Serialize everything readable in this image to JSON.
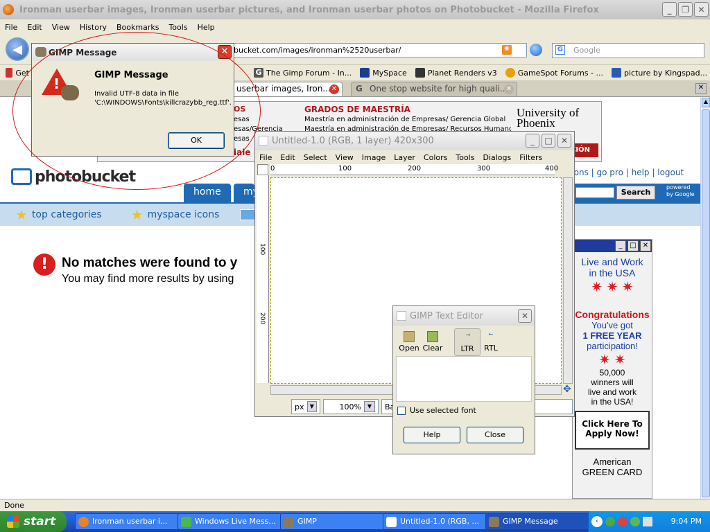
{
  "firefox": {
    "title": "Ironman userbar images, Ironman userbar pictures, and Ironman userbar photos on Photobucket - Mozilla Firefox",
    "menu": [
      "File",
      "Edit",
      "View",
      "History",
      "Bookmarks",
      "Tools",
      "Help"
    ],
    "url": "bucket.com/images/ironman%2520userbar/",
    "search_placeholder": "Google",
    "bookmarks": [
      {
        "label": "Get"
      },
      {
        "label": "The Gimp Forum - In..."
      },
      {
        "label": "MySpace"
      },
      {
        "label": "Planet Renders v3"
      },
      {
        "label": "GameSpot Forums - ..."
      },
      {
        "label": "picture by Kingspad..."
      }
    ],
    "tabs": [
      {
        "label": "userbar images, Iron..."
      },
      {
        "label": "One stop website for high quali..."
      }
    ],
    "status": "Done"
  },
  "page": {
    "ad": {
      "left_col": [
        "OS",
        "esas",
        "esas/Gerencia",
        "esas"
      ],
      "heading": "GRADOS DE MAESTRÍA",
      "line1": "Maestría en administración de Empresas/ Gerencia Global",
      "line2": "Maestría en administración de Empresas/ Recursos Humanos",
      "brand": "University of Phoenix",
      "cta": "CIÓN",
      "cut_text": "iale"
    },
    "logo": "photobucket",
    "toplinks": [
      "ptions",
      "go pro",
      "help",
      "logout"
    ],
    "nav_tabs": [
      "home",
      "my"
    ],
    "search_button": "Search",
    "powered": "powered by Google",
    "categories": [
      "top categories",
      "myspace icons"
    ],
    "no_match_title": "No matches were found to y",
    "no_match_sub": "You may find more results by using",
    "side_ad": {
      "l1": "Live and Work",
      "l2": "in the USA",
      "l3": "Congratulations",
      "l4": "You've got",
      "l5": "1 FREE YEAR",
      "l6": "participation!",
      "l7": "50,000",
      "l8": "winners will",
      "l9": "live and work",
      "l10": "in the USA!",
      "button": "Click Here To Apply Now!",
      "l11": "American",
      "l12": "GREEN CARD"
    }
  },
  "gimp_image": {
    "title": "Untitled-1.0 (RGB, 1 layer) 420x300",
    "menu": [
      "File",
      "Edit",
      "Select",
      "View",
      "Image",
      "Layer",
      "Colors",
      "Tools",
      "Dialogs",
      "Filters"
    ],
    "ruler": [
      "0",
      "100",
      "200",
      "300",
      "400"
    ],
    "vruler": [
      "100",
      "200"
    ],
    "unit": "px",
    "zoom": "100%",
    "status_cut": "Ba"
  },
  "gimp_message": {
    "title": "GIMP Message",
    "heading": "GIMP Message",
    "body": "Invalid UTF-8 data in file 'C:\\WINDOWS\\Fonts\\killcrazybb_reg.ttf'.",
    "ok": "OK"
  },
  "text_editor": {
    "title": "GIMP Text Editor",
    "tools": [
      "Open",
      "Clear",
      "LTR",
      "RTL"
    ],
    "checkbox": "Use selected font",
    "help": "Help",
    "close": "Close"
  },
  "taskbar": {
    "start": "start",
    "tasks": [
      "Ironman userbar i...",
      "Windows Live Mess...",
      "GIMP",
      "Untitled-1.0 (RGB, ...",
      "GIMP Message"
    ],
    "clock": "9:04 PM"
  },
  "colors": {
    "photobucket_blue": "#1f6ab4",
    "annotation_red": "#d21a1a"
  }
}
